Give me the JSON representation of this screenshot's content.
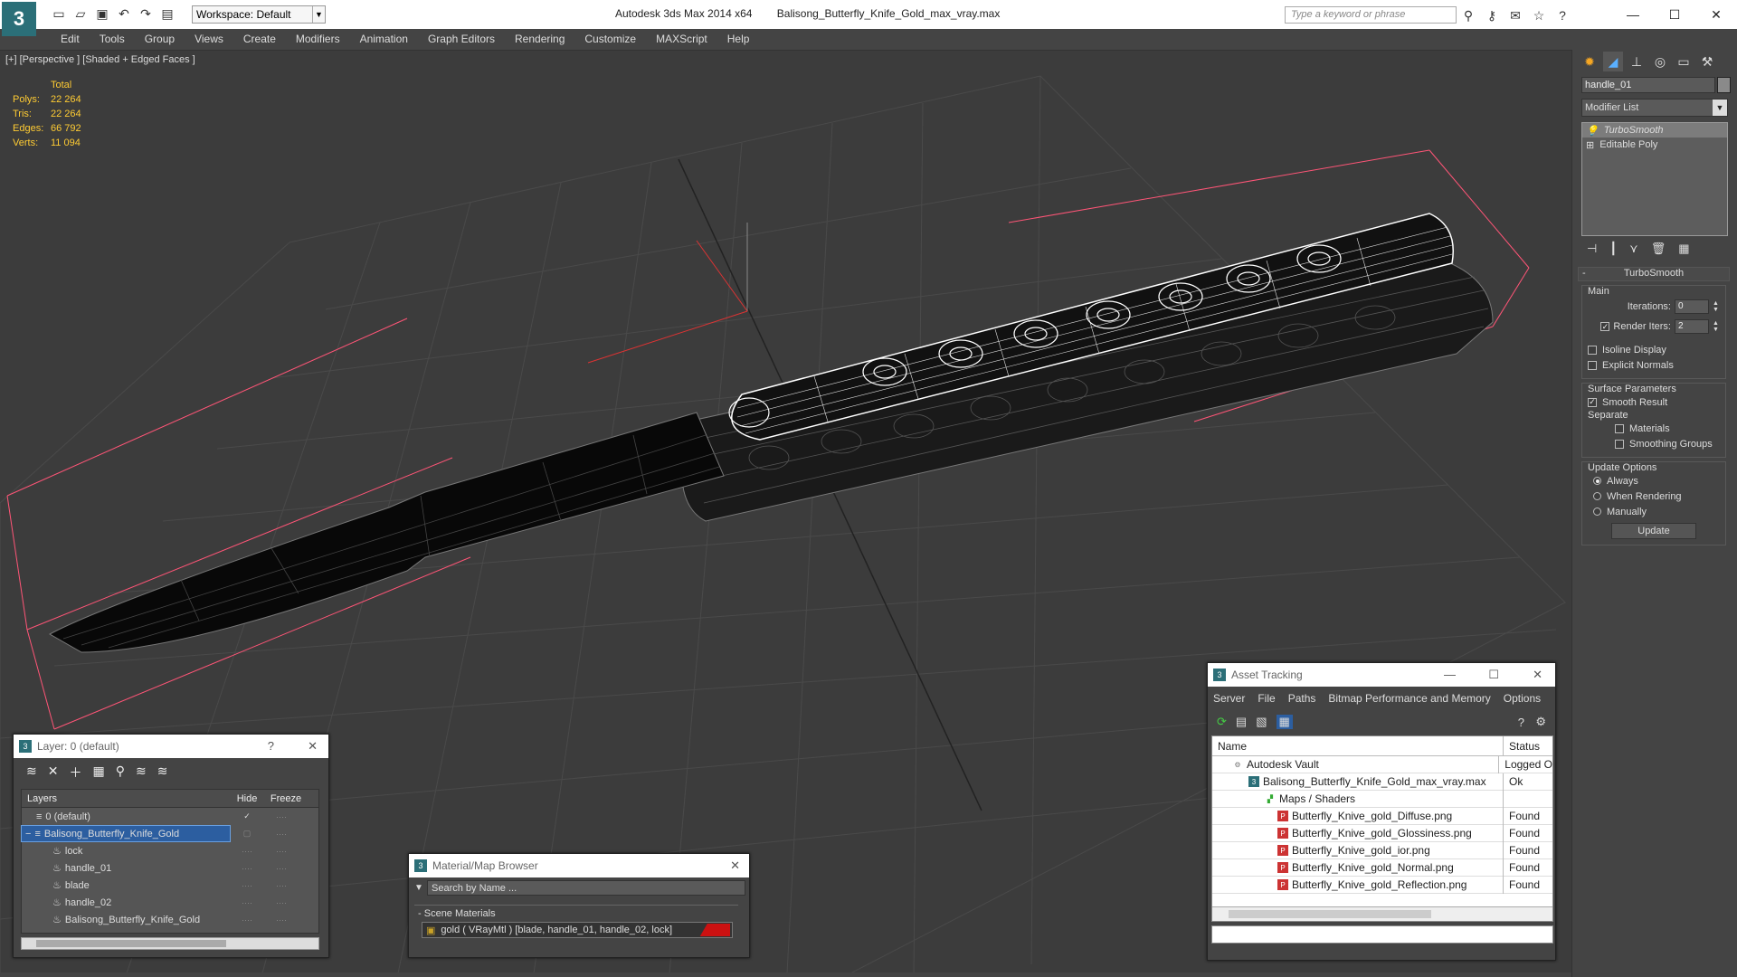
{
  "titlebar": {
    "app_name": "Autodesk 3ds Max  2014 x64",
    "file_name": "Balisong_Butterfly_Knife_Gold_max_vray.max",
    "workspace": "Workspace: Default",
    "search_placeholder": "Type a keyword or phrase"
  },
  "menu": [
    "Edit",
    "Tools",
    "Group",
    "Views",
    "Create",
    "Modifiers",
    "Animation",
    "Graph Editors",
    "Rendering",
    "Customize",
    "MAXScript",
    "Help"
  ],
  "viewport": {
    "label": "[+] [Perspective ] [Shaded + Edged Faces ]",
    "stats_header": "Total",
    "stats": [
      {
        "label": "Polys:",
        "value": "22 264"
      },
      {
        "label": "Tris:",
        "value": "22 264"
      },
      {
        "label": "Edges:",
        "value": "66 792"
      },
      {
        "label": "Verts:",
        "value": "11 094"
      }
    ]
  },
  "command_panel": {
    "object_name": "handle_01",
    "modifier_list": "Modifier List",
    "stack": [
      "TurboSmooth",
      "Editable Poly"
    ],
    "turbosmooth": {
      "title": "TurboSmooth",
      "main": "Main",
      "iterations_label": "Iterations:",
      "iterations_value": "0",
      "render_iters_label": "Render Iters:",
      "render_iters_value": "2",
      "render_iters_checked": true,
      "isoline_display": "Isoline Display",
      "explicit_normals": "Explicit Normals",
      "surface_parameters": "Surface Parameters",
      "smooth_result": "Smooth Result",
      "separate": "Separate",
      "materials": "Materials",
      "smoothing_groups": "Smoothing Groups",
      "update_options": "Update Options",
      "always": "Always",
      "when_rendering": "When Rendering",
      "manually": "Manually",
      "update_button": "Update"
    }
  },
  "layer_window": {
    "title": "Layer: 0 (default)",
    "columns": [
      "Layers",
      "Hide",
      "Freeze"
    ],
    "rows": [
      {
        "name": "0 (default)",
        "indent": 0
      },
      {
        "name": "Balisong_Butterfly_Knife_Gold",
        "indent": 0
      },
      {
        "name": "lock",
        "indent": 1
      },
      {
        "name": "handle_01",
        "indent": 1
      },
      {
        "name": "blade",
        "indent": 1
      },
      {
        "name": "handle_02",
        "indent": 1
      },
      {
        "name": "Balisong_Butterfly_Knife_Gold",
        "indent": 1
      }
    ]
  },
  "material_browser": {
    "title": "Material/Map Browser",
    "search_placeholder": "Search by Name ...",
    "section": "Scene Materials",
    "item": "gold  ( VRayMtl )  [blade, handle_01, handle_02, lock]"
  },
  "asset_tracking": {
    "title": "Asset Tracking",
    "menu": [
      "Server",
      "File",
      "Paths",
      "Bitmap Performance and Memory",
      "Options"
    ],
    "columns": [
      "Name",
      "Status"
    ],
    "rows": [
      {
        "name": "Autodesk Vault",
        "status": "Logged O",
        "icon": "vault-icon"
      },
      {
        "name": "Balisong_Butterfly_Knife_Gold_max_vray.max",
        "status": "Ok",
        "icon": "max-file-icon"
      },
      {
        "name": "Maps / Shaders",
        "status": "",
        "icon": "maps-icon"
      },
      {
        "name": "Butterfly_Knive_gold_Diffuse.png",
        "status": "Found",
        "icon": "png-icon"
      },
      {
        "name": "Butterfly_Knive_gold_Glossiness.png",
        "status": "Found",
        "icon": "png-icon"
      },
      {
        "name": "Butterfly_Knive_gold_ior.png",
        "status": "Found",
        "icon": "png-icon"
      },
      {
        "name": "Butterfly_Knive_gold_Normal.png",
        "status": "Found",
        "icon": "png-icon"
      },
      {
        "name": "Butterfly_Knive_gold_Reflection.png",
        "status": "Found",
        "icon": "png-icon"
      }
    ]
  },
  "colors": {
    "selection": "#2c5ea0",
    "stats": "#ffcc33",
    "bounding_box": "#ff5577"
  }
}
